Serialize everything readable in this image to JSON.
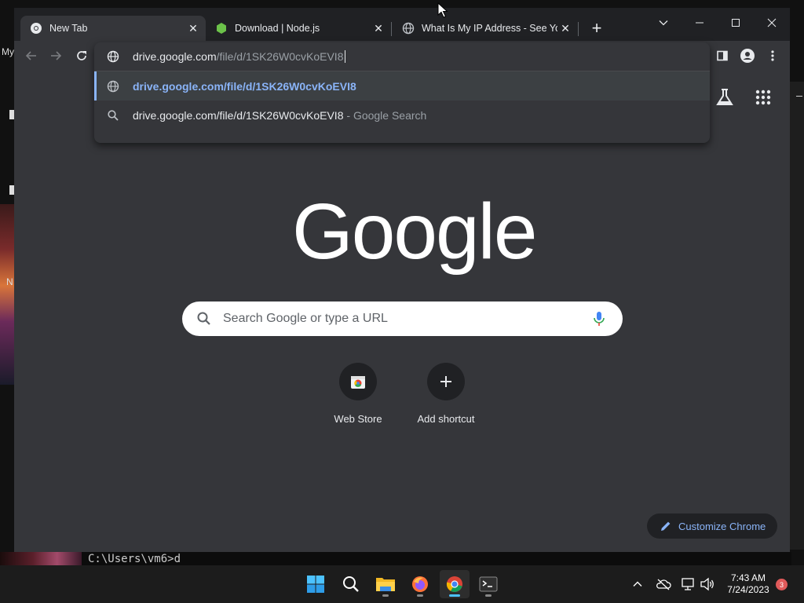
{
  "desktop": {
    "left_labels": [
      "My",
      "N"
    ],
    "terminal_line": "C:\\Users\\vm6>d"
  },
  "tabs": [
    {
      "title": "New Tab",
      "icon": "chrome-icon",
      "active": true
    },
    {
      "title": "Download | Node.js",
      "icon": "nodejs-icon",
      "active": false
    },
    {
      "title": "What Is My IP Address - See You",
      "icon": "globe-icon",
      "active": false
    }
  ],
  "window_controls": [
    "tab-search",
    "minimize",
    "maximize",
    "close"
  ],
  "omnibox": {
    "typed_domain": "drive.google.com",
    "typed_path": "/file/d/1SK26W0cvKoEVI8",
    "suggestions": [
      {
        "type": "url",
        "icon": "globe-icon",
        "text": "drive.google.com/file/d/1SK26W0cvKoEVI8",
        "selected": true
      },
      {
        "type": "search",
        "icon": "search-icon",
        "text": "drive.google.com/file/d/1SK26W0cvKoEVI8",
        "separator": " - ",
        "suffix": "Google Search",
        "selected": false
      }
    ]
  },
  "ntp": {
    "logo": "Google",
    "search_placeholder": "Search Google or type a URL",
    "shortcuts": [
      {
        "label": "Web Store",
        "icon": "webstore-icon"
      },
      {
        "label": "Add shortcut",
        "icon": "plus-icon"
      }
    ],
    "customize_label": "Customize Chrome"
  },
  "taskbar": {
    "apps": [
      "windows-start",
      "search",
      "file-explorer",
      "firefox",
      "chrome",
      "terminal"
    ],
    "time": "7:43 AM",
    "date": "7/24/2023",
    "notification_count": "3"
  },
  "colors": {
    "accent_link": "#8ab4f8",
    "tabstrip_bg": "#202124",
    "toolbar_bg": "#35363a",
    "taskbar_active": "#4cc2ff"
  }
}
